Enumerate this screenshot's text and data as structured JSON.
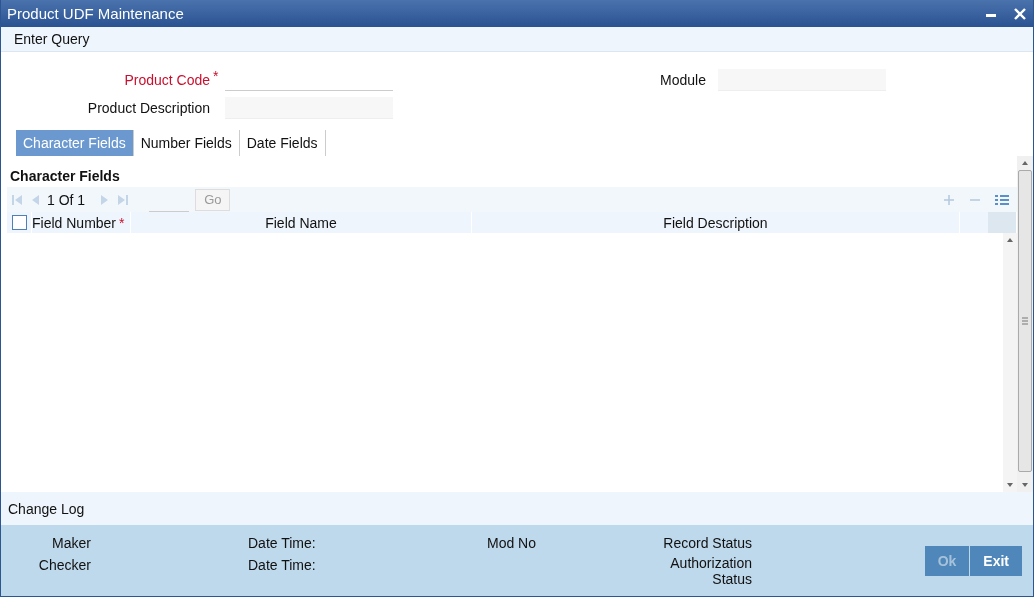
{
  "window": {
    "title": "Product UDF Maintenance"
  },
  "toolbar": {
    "items": [
      "Enter Query"
    ]
  },
  "form": {
    "product_code": {
      "label": "Product Code",
      "required": true,
      "required_mark": "*"
    },
    "product_description": {
      "label": "Product Description"
    },
    "module": {
      "label": "Module"
    }
  },
  "tabs": [
    {
      "label": "Character Fields",
      "selected": true
    },
    {
      "label": "Number Fields",
      "selected": false
    },
    {
      "label": "Date Fields",
      "selected": false
    }
  ],
  "section": {
    "title": "Character Fields",
    "pager": {
      "text": "1 Of 1",
      "go": "Go",
      "disabled": true
    },
    "table": {
      "select_all": {
        "checked": false
      },
      "columns": [
        {
          "label": "Field Number",
          "required": true,
          "required_mark": "*"
        },
        {
          "label": "Field Name",
          "required": false
        },
        {
          "label": "Field Description",
          "required": false
        }
      ]
    }
  },
  "change_log": {
    "title": "Change Log"
  },
  "footer": {
    "maker": "Maker",
    "checker": "Checker",
    "date_time_1": "Date Time:",
    "date_time_2": "Date Time:",
    "mod_no": "Mod No",
    "record_status": "Record Status",
    "authorization_status": "Authorization Status"
  },
  "buttons": [
    {
      "label": "Ok",
      "disabled": true
    },
    {
      "label": "Exit",
      "disabled": false
    }
  ]
}
